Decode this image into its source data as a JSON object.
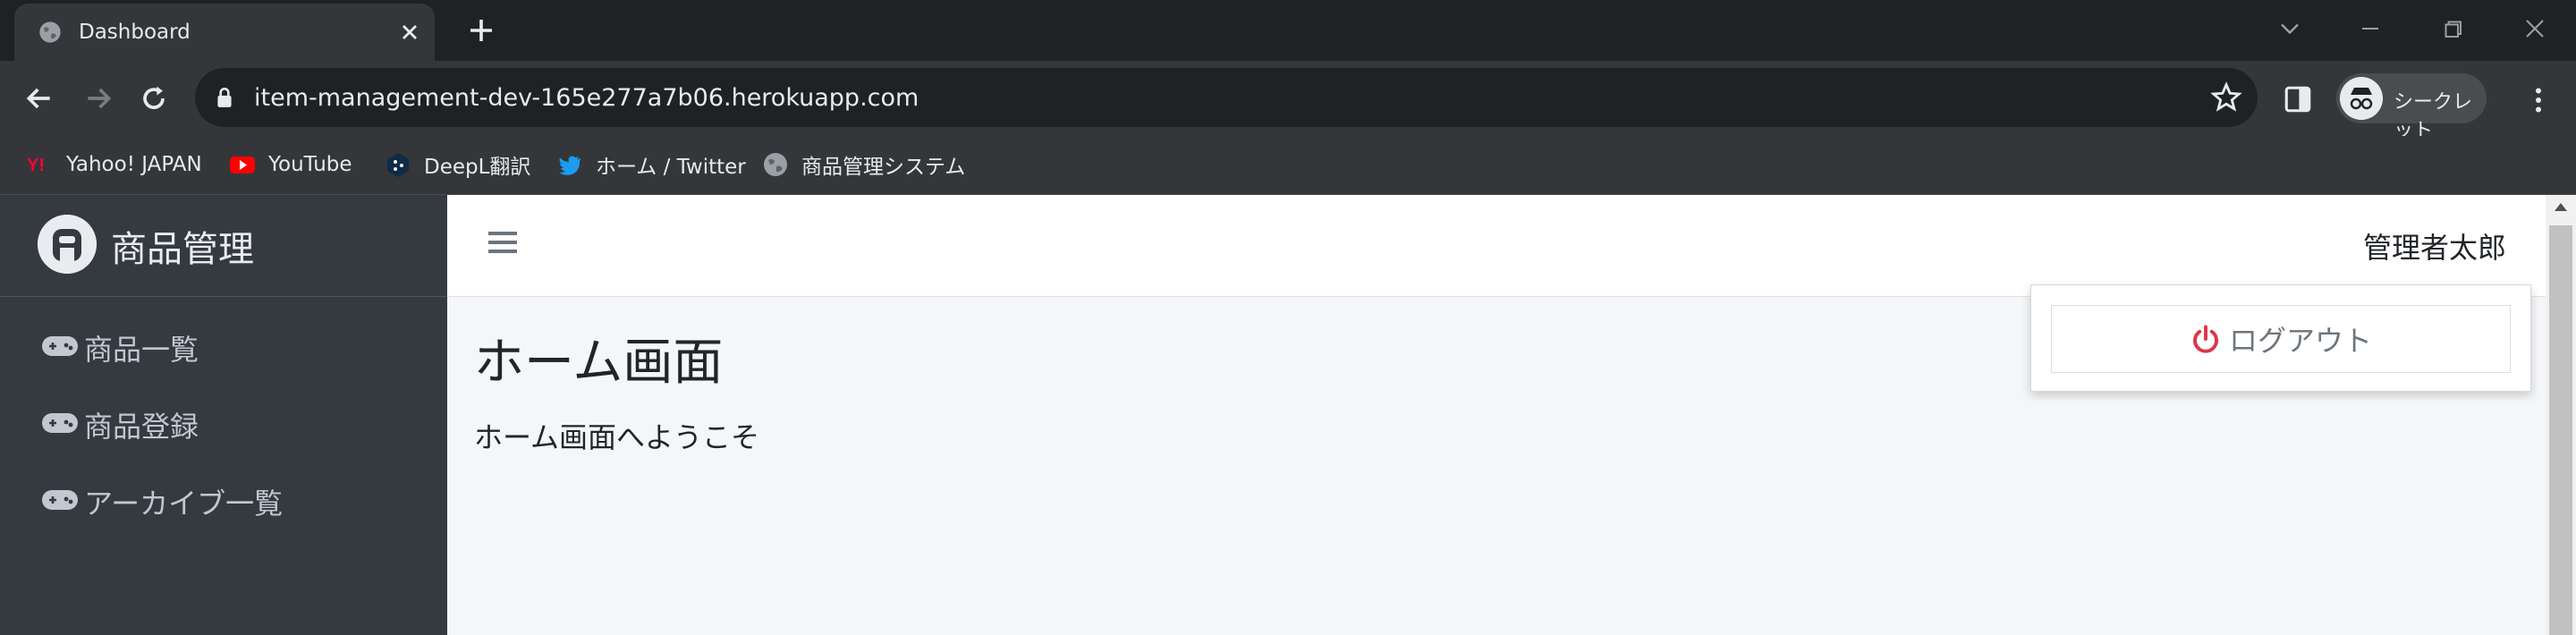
{
  "browser": {
    "tab_title": "Dashboard",
    "url": "item-management-dev-165e277a7b06.herokuapp.com",
    "incognito_label": "シークレット",
    "bookmarks": [
      {
        "label": "Yahoo! JAPAN",
        "icon": "yahoo-icon"
      },
      {
        "label": "YouTube",
        "icon": "youtube-icon"
      },
      {
        "label": "DeepL翻訳",
        "icon": "deepl-icon"
      },
      {
        "label": "ホーム / Twitter",
        "icon": "twitter-icon"
      },
      {
        "label": "商品管理システム",
        "icon": "globe-icon"
      }
    ]
  },
  "sidebar": {
    "brand": "商品管理",
    "items": [
      {
        "label": "商品一覧",
        "icon": "gamepad-icon"
      },
      {
        "label": "商品登録",
        "icon": "gamepad-icon"
      },
      {
        "label": "アーカイブ一覧",
        "icon": "gamepad-icon"
      }
    ]
  },
  "header": {
    "user_name": "管理者太郎"
  },
  "main": {
    "heading": "ホーム画面",
    "welcome": "ホーム画面へようこそ"
  },
  "dropdown": {
    "logout_label": "ログアウト"
  },
  "colors": {
    "sidebar_bg": "#343a40",
    "content_bg": "#f4f6f9",
    "logout_icon": "#dc3545",
    "browser_dark": "#202124",
    "browser_toolbar": "#35363a"
  }
}
